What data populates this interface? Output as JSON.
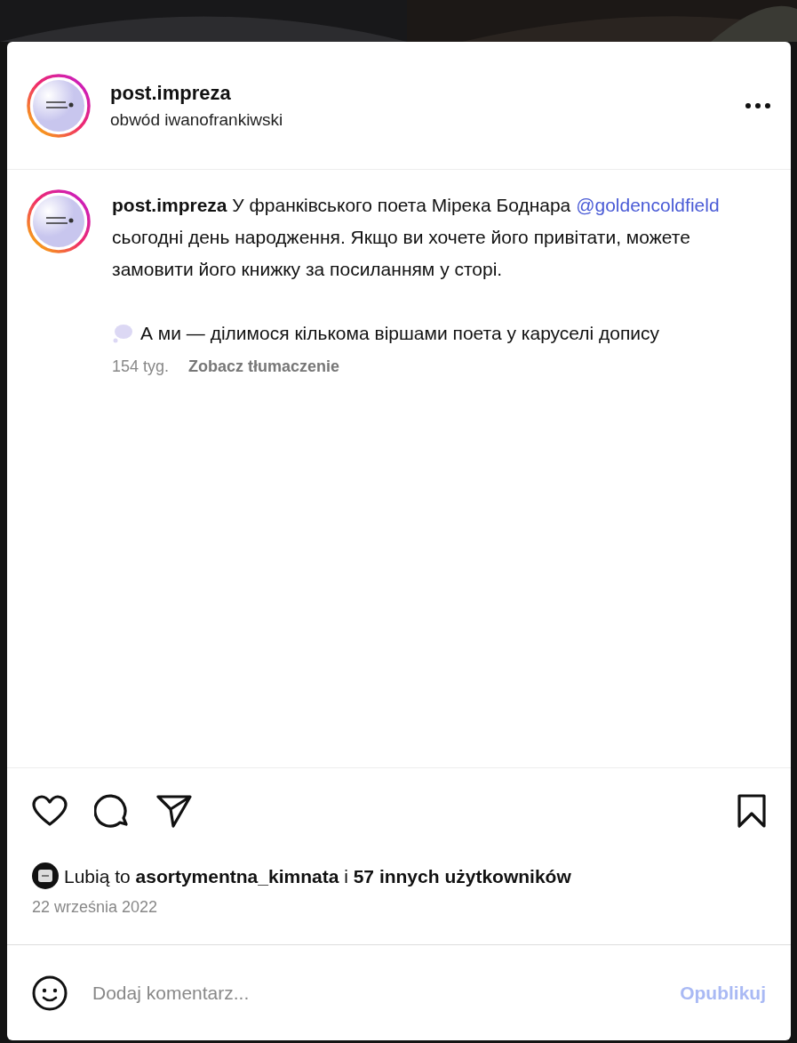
{
  "header": {
    "username": "post.impreza",
    "location": "obwód iwanofrankiwski"
  },
  "caption": {
    "author": "post.impreza",
    "text_before": "У франківського поета Мірека Боднара",
    "mention": "@goldencoldfield",
    "text_after": "сьогодні день народження. Якщо ви хочете його привітати, можете замовити його книжку за посиланням у сторі.",
    "second_paragraph": "А ми — ділимося кількома віршами поета у каруселі допису",
    "age": "154 tyg.",
    "translate": "Zobacz tłumaczenie"
  },
  "actions": {
    "liked": false,
    "saved": false
  },
  "likes": "Lubią to **asortymentna_kimnata** i **57 innych użytkowników**",
  "date": "22 września 2022",
  "comment": {
    "placeholder": "Dodaj komentarz...",
    "submit": "Opublikuj",
    "submit_disabled": true
  }
}
